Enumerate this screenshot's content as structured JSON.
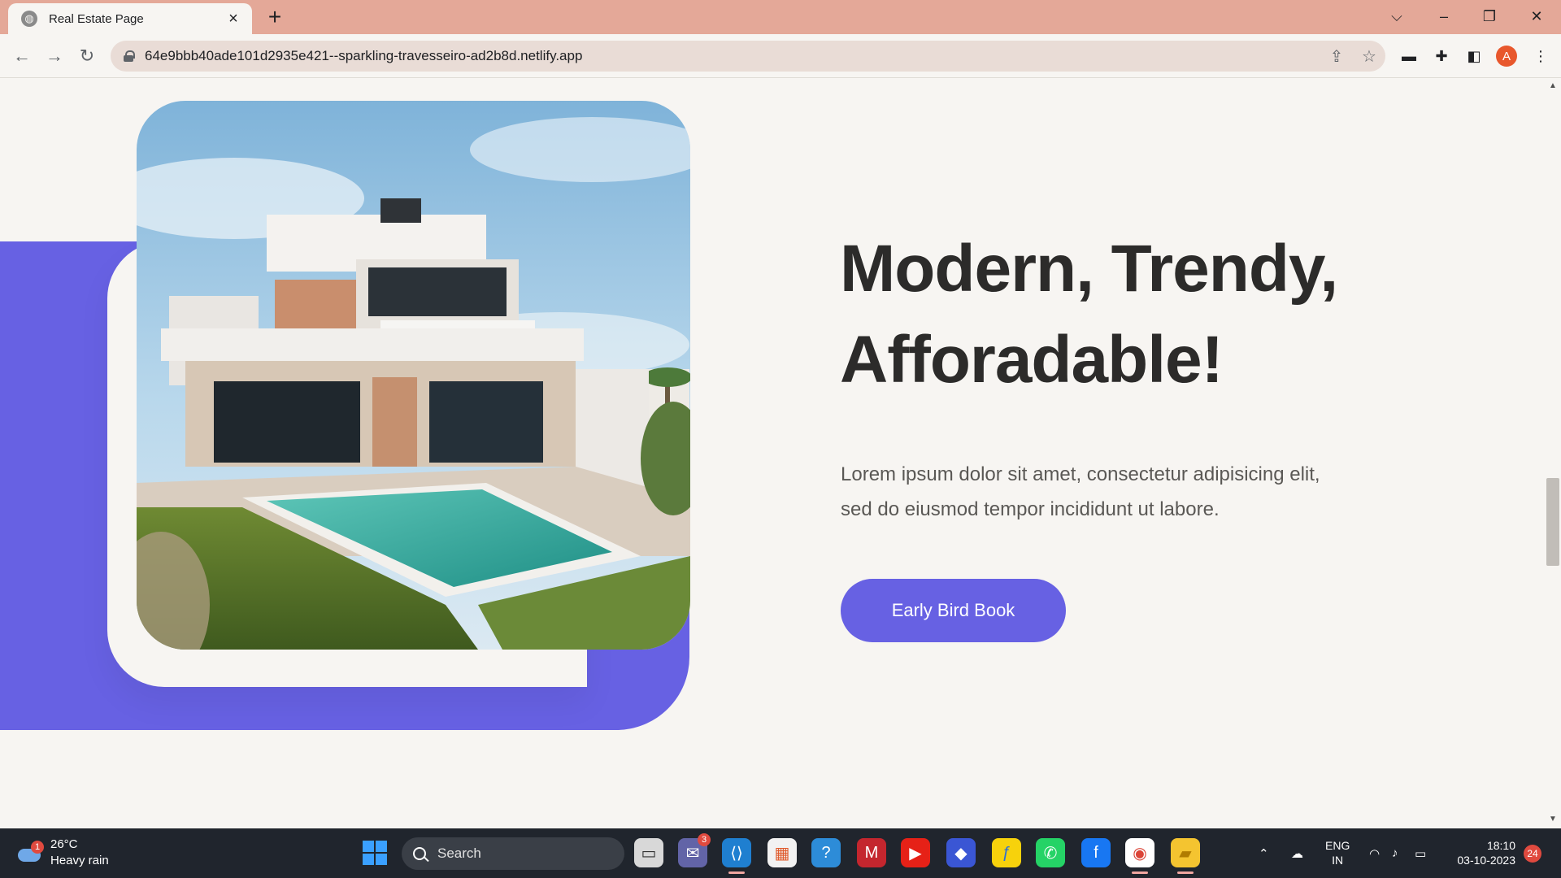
{
  "browser": {
    "tab_title": "Real Estate Page",
    "url": "64e9bbb40ade101d2935e421--sparkling-travesseiro-ad2b8d.netlify.app",
    "profile_initial": "A"
  },
  "hero": {
    "title_line1": "Modern, Trendy,",
    "title_line2": "Afforadable!",
    "description_line1": "Lorem ipsum dolor sit amet, consectetur adipisicing elit,",
    "description_line2": "sed do eiusmod tempor incididunt ut labore.",
    "cta_label": "Early Bird Book",
    "image_icon": "modern-villa-with-pool-photo"
  },
  "colors": {
    "accent": "#6761e3",
    "background": "#f7f5f2",
    "tab_strip": "#e4a898",
    "heading": "#2c2b2a",
    "body_text": "#5a5855"
  },
  "taskbar": {
    "weather_temp": "26°C",
    "weather_condition": "Heavy rain",
    "weather_badge": "1",
    "search_label": "Search",
    "teams_badge": "3",
    "lang_line1": "ENG",
    "lang_line2": "IN",
    "time": "18:10",
    "date": "03-10-2023",
    "notification_count": "24"
  }
}
